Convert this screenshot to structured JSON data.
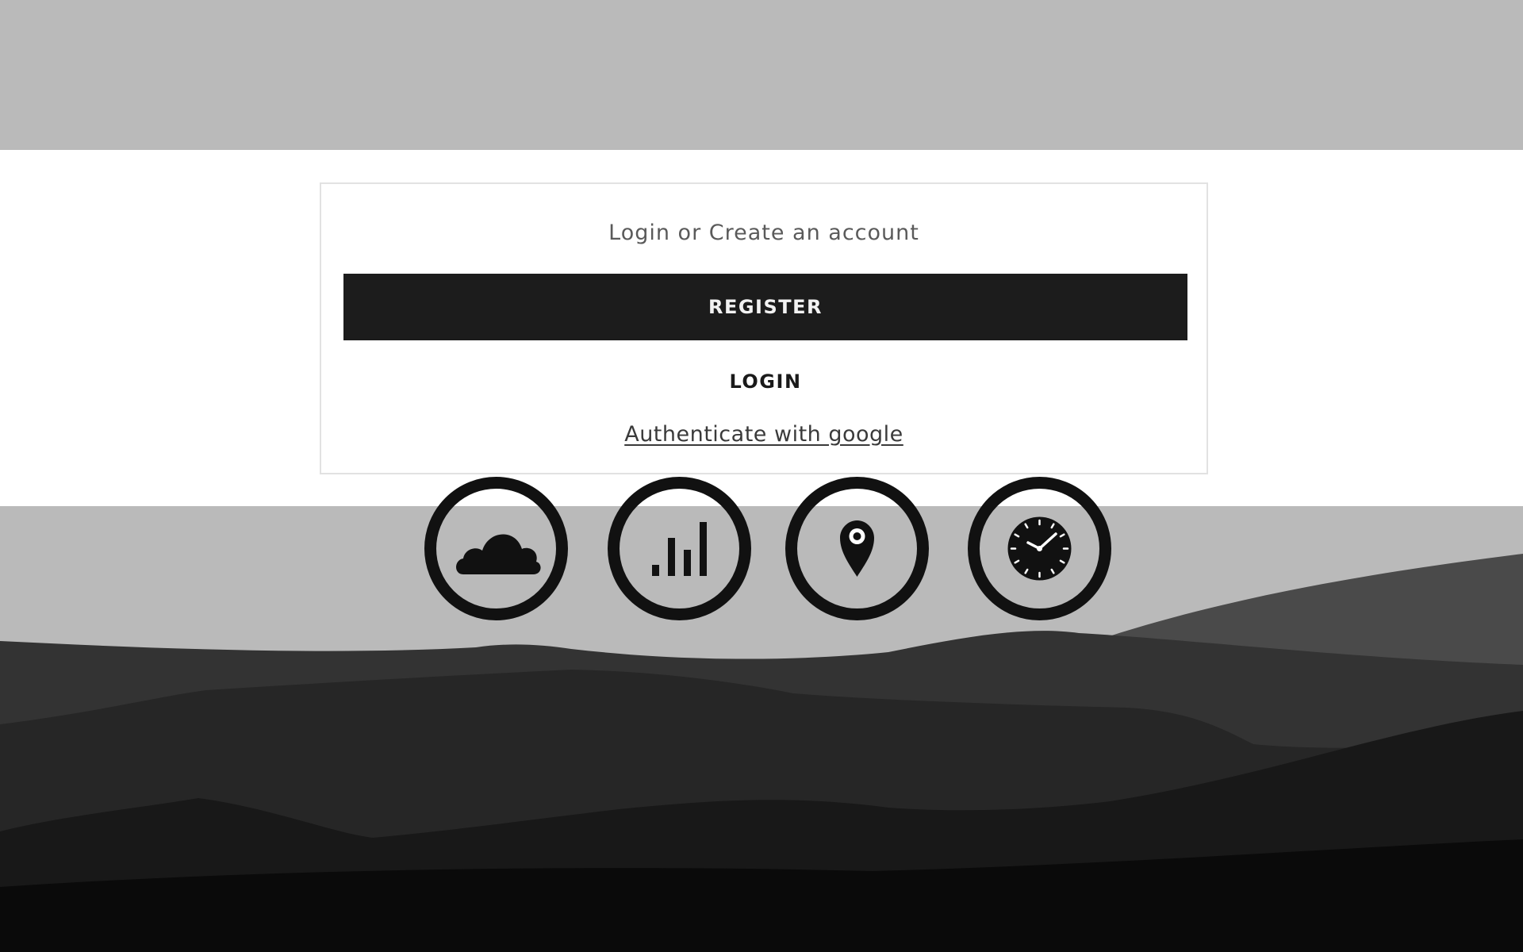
{
  "auth": {
    "heading": "Login or Create an account",
    "register_label": "REGISTER",
    "login_label": "LOGIN",
    "google_label": "Authenticate with google"
  },
  "icon_buttons": [
    {
      "icon": "cloud-icon"
    },
    {
      "icon": "signal-bars-icon"
    },
    {
      "icon": "map-pin-icon"
    },
    {
      "icon": "clock-icon"
    }
  ],
  "colors": {
    "band_gray": "#bababa",
    "card_border": "#e2e2e2",
    "button_dark": "#1c1c1c",
    "icon_black": "#111111"
  }
}
